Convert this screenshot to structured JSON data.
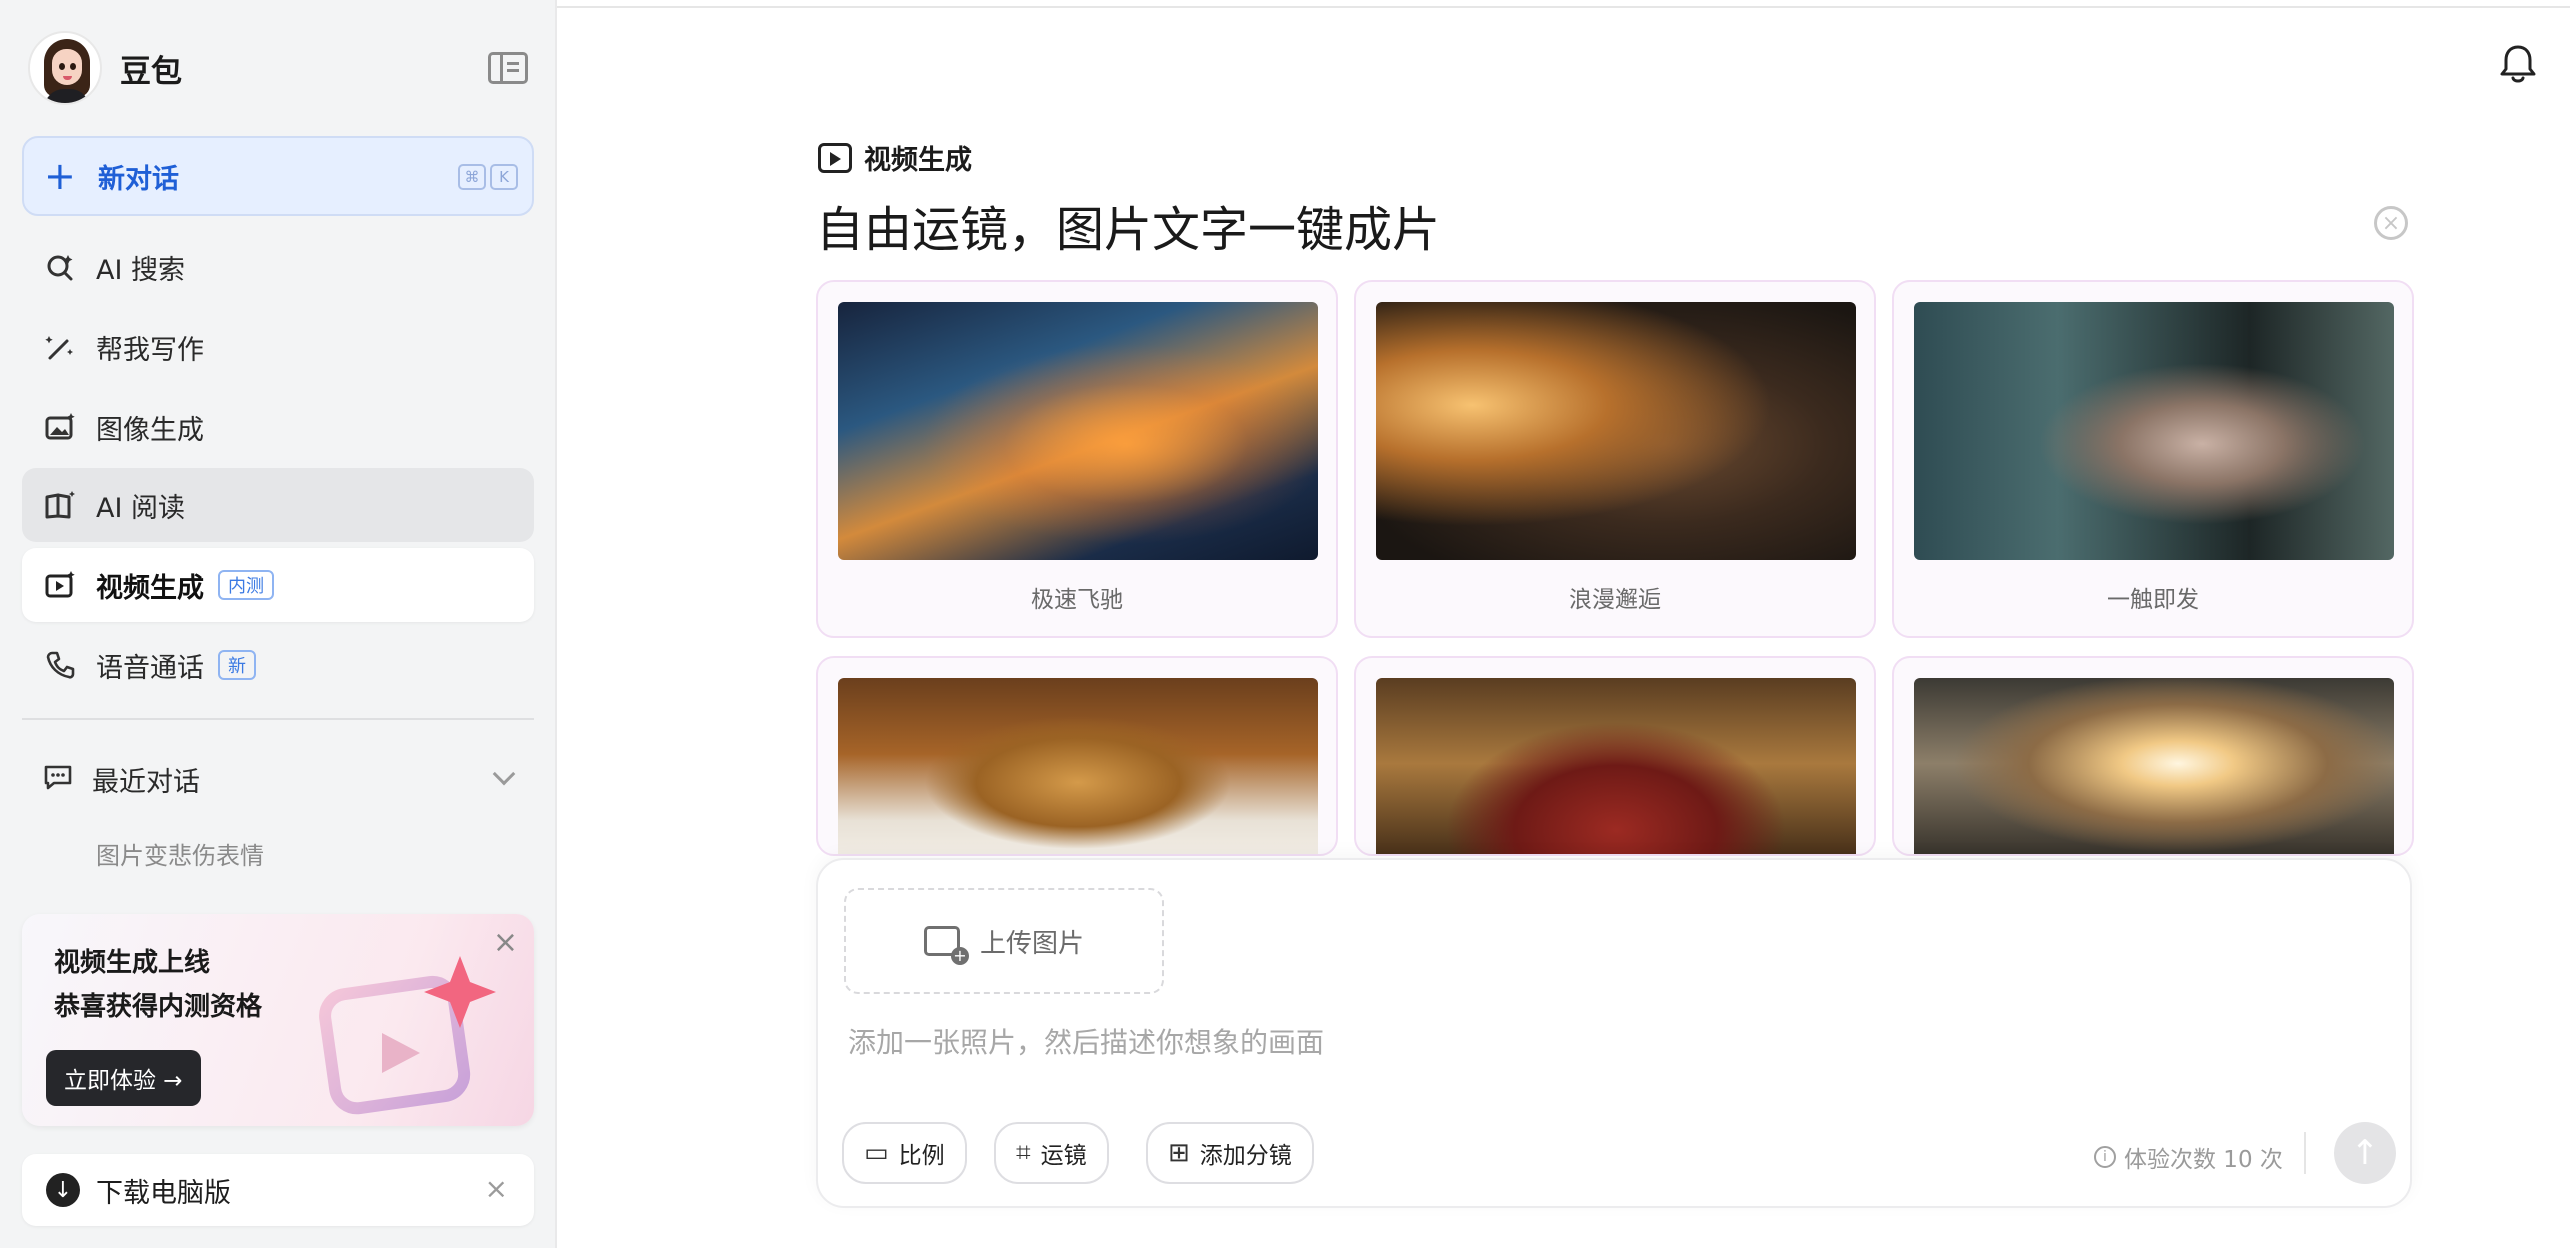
{
  "brand": {
    "name": "豆包"
  },
  "new_chat": {
    "label": "新对话",
    "shortcut": [
      "⌘",
      "K"
    ]
  },
  "nav": [
    {
      "id": "ai-search",
      "label": "AI 搜索",
      "icon": "search-sparkle-icon"
    },
    {
      "id": "writing",
      "label": "帮我写作",
      "icon": "pen-sparkle-icon"
    },
    {
      "id": "image-gen",
      "label": "图像生成",
      "icon": "image-sparkle-icon"
    },
    {
      "id": "ai-reading",
      "label": "AI 阅读",
      "icon": "book-sparkle-icon"
    },
    {
      "id": "video-gen",
      "label": "视频生成",
      "icon": "video-sparkle-icon",
      "badge": "内测"
    },
    {
      "id": "voice-call",
      "label": "语音通话",
      "icon": "phone-icon",
      "badge": "新"
    }
  ],
  "recent": {
    "title": "最近对话",
    "items": [
      "图片变悲伤表情"
    ]
  },
  "promo": {
    "line1": "视频生成上线",
    "line2": "恭喜获得内测资格",
    "button": "立即体验 →"
  },
  "download": {
    "label": "下载电脑版"
  },
  "main": {
    "mode_label": "视频生成",
    "headline": "自由运镜，图片文字一键成片",
    "cards": [
      {
        "caption": "极速飞驰",
        "image": "speeding-car-city-street"
      },
      {
        "caption": "浪漫邂逅",
        "image": "woman-profile-warm-light"
      },
      {
        "caption": "一触即发",
        "image": "woman-sunglasses-dark"
      },
      {
        "caption": "",
        "image": "dog-reading-on-bed"
      },
      {
        "caption": "",
        "image": "cartoon-figures-red-sofa"
      },
      {
        "caption": "",
        "image": "man-at-cliff-sunrise"
      }
    ]
  },
  "composer": {
    "upload_label": "上传图片",
    "placeholder": "添加一张照片，然后描述你想象的画面",
    "tools": {
      "ratio": "比例",
      "camera": "运镜",
      "add_shot": "添加分镜"
    },
    "quota": "体验次数 10 次"
  },
  "colors": {
    "accent": "#1f5fd6",
    "new_chat_bg": "#e6efff",
    "sidebar_bg": "#f3f4f5",
    "card_border": "#f1def4"
  }
}
